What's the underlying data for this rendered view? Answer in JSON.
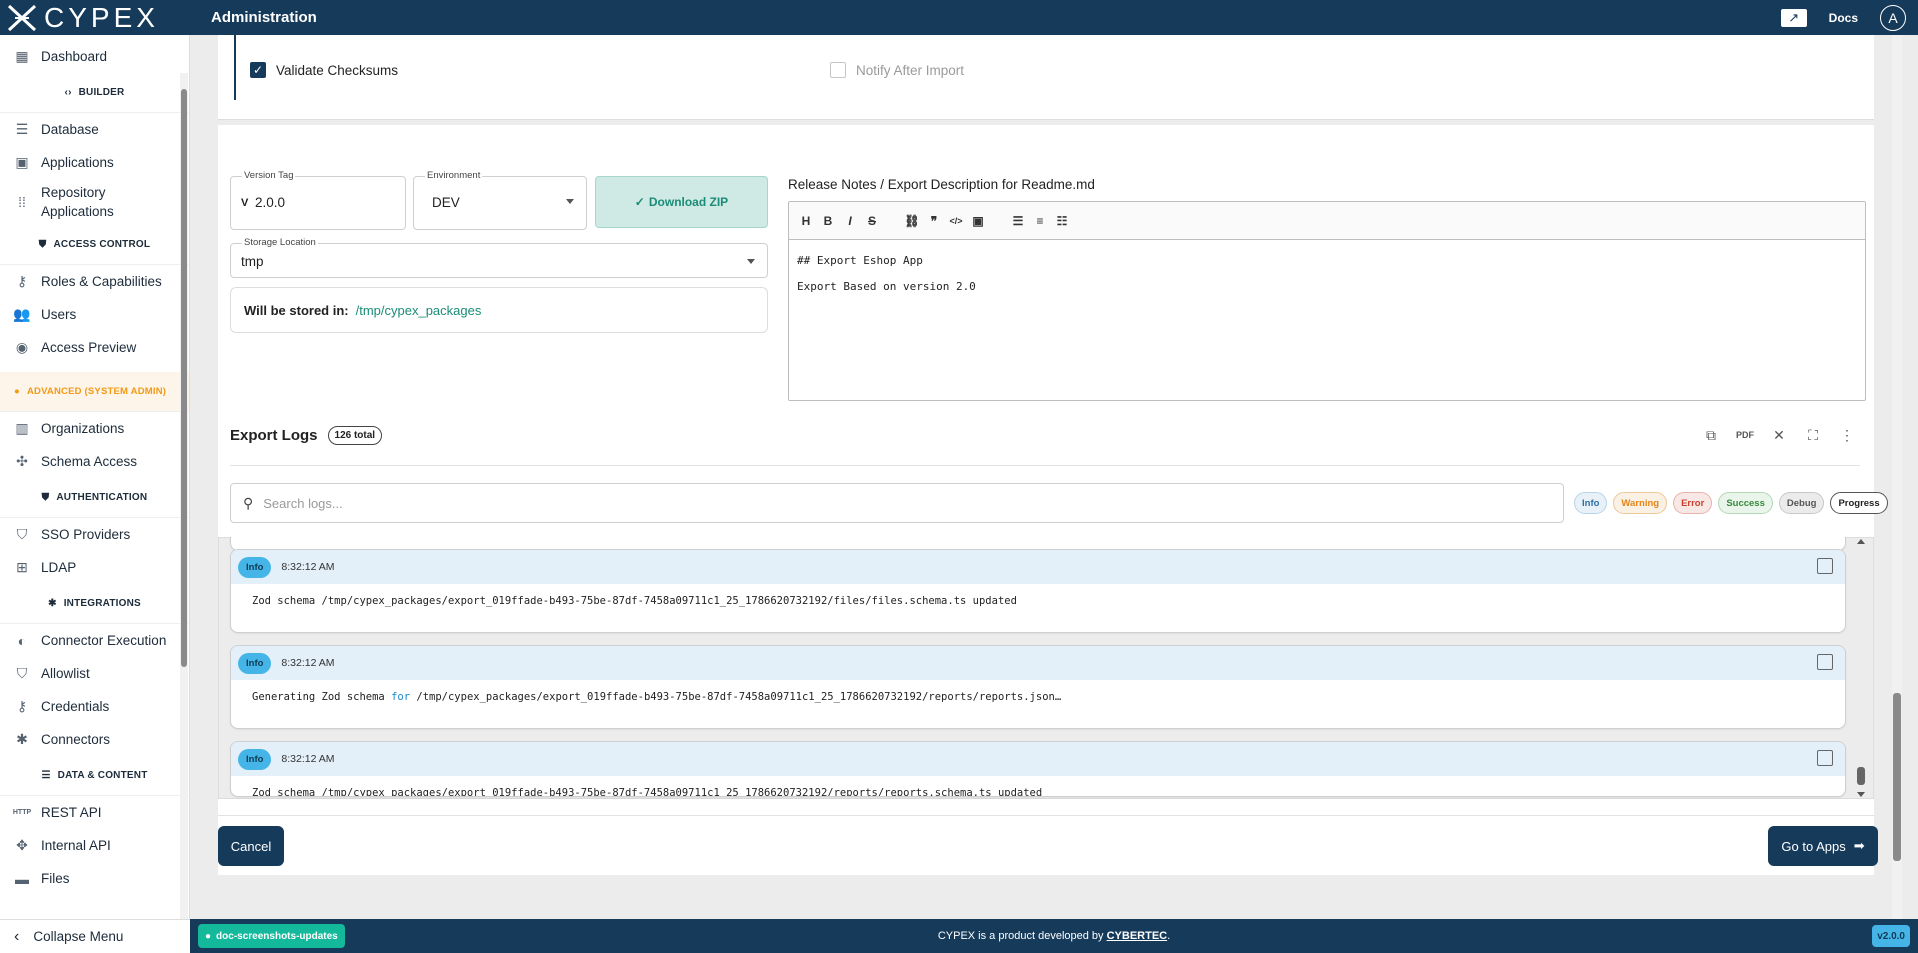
{
  "app": {
    "brand": "CYPEX",
    "page_title": "Administration",
    "docs_label": "Docs",
    "avatar_initial": "A"
  },
  "sidebar": {
    "items": [
      {
        "label": "Dashboard",
        "icon": "dashboard-icon"
      },
      {
        "section": "BUILDER",
        "icon": "code-icon"
      },
      {
        "label": "Database",
        "icon": "list-icon"
      },
      {
        "label": "Applications",
        "icon": "app-icon"
      },
      {
        "label": "Repository Applications",
        "icon": "grid-icon"
      },
      {
        "section": "ACCESS CONTROL",
        "icon": "shield-icon"
      },
      {
        "label": "Roles & Capabilities",
        "icon": "key-icon"
      },
      {
        "label": "Users",
        "icon": "users-icon"
      },
      {
        "label": "Access Preview",
        "icon": "eye-icon"
      },
      {
        "section": "ADVANCED (SYSTEM ADMIN)",
        "icon": "warning-icon"
      },
      {
        "label": "Organizations",
        "icon": "building-icon"
      },
      {
        "label": "Schema Access",
        "icon": "puzzle-icon"
      },
      {
        "section": "AUTHENTICATION",
        "icon": "verified-icon"
      },
      {
        "label": "SSO Providers",
        "icon": "shield-icon"
      },
      {
        "label": "LDAP",
        "icon": "tree-icon"
      },
      {
        "section": "INTEGRATIONS",
        "icon": "hub-icon"
      },
      {
        "label": "Connector Execution",
        "icon": "toggle-icon"
      },
      {
        "label": "Allowlist",
        "icon": "shield-icon"
      },
      {
        "label": "Credentials",
        "icon": "key-icon"
      },
      {
        "label": "Connectors",
        "icon": "hub-icon"
      },
      {
        "section": "DATA & CONTENT",
        "icon": "list-icon"
      },
      {
        "label": "REST API",
        "icon": "http-icon"
      },
      {
        "label": "Internal API",
        "icon": "api-icon"
      },
      {
        "label": "Files",
        "icon": "folder-icon"
      }
    ],
    "collapse_label": "Collapse Menu"
  },
  "options": {
    "validate_checksums": {
      "label": "Validate Checksums",
      "checked": true
    },
    "notify_after_import": {
      "label": "Notify After Import",
      "checked": false
    }
  },
  "form": {
    "version_tag": {
      "label": "Version Tag",
      "prefix": "V",
      "value": "2.0.0"
    },
    "environment": {
      "label": "Environment",
      "value": "DEV"
    },
    "download_label": "Download ZIP",
    "storage_location": {
      "label": "Storage Location",
      "value": "tmp"
    },
    "stored_in": {
      "label": "Will be stored in:",
      "path": "/tmp/cypex_packages"
    }
  },
  "release_notes": {
    "title": "Release Notes / Export Description for Readme.md",
    "toolbar": [
      "H",
      "B",
      "I",
      "S",
      "link",
      "quote",
      "code",
      "image",
      "bullet-list",
      "numbered-list",
      "task-list"
    ],
    "lines": [
      "## Export Eshop App",
      "Export Based on version 2.0"
    ]
  },
  "logs": {
    "title": "Export Logs",
    "total": "126 total",
    "search_placeholder": "Search logs...",
    "filters": [
      "Info",
      "Warning",
      "Error",
      "Success",
      "Debug",
      "Progress"
    ],
    "entries": [
      {
        "level": "Info",
        "time": "8:32:12 AM",
        "message": "Zod schema /tmp/cypex_packages/export_019ffade-b493-75be-87df-7458a09711c1_25_1786620732192/files/files.schema.ts updated"
      },
      {
        "level": "Info",
        "time": "8:32:12 AM",
        "message_pre": "Generating Zod schema ",
        "message_kw": "for",
        "message_post": " /tmp/cypex_packages/export_019ffade-b493-75be-87df-7458a09711c1_25_1786620732192/reports/reports.json…"
      },
      {
        "level": "Info",
        "time": "8:32:12 AM",
        "message": "Zod schema /tmp/cypex_packages/export_019ffade-b493-75be-87df-7458a09711c1_25_1786620732192/reports/reports.schema.ts updated"
      }
    ]
  },
  "actions": {
    "cancel": "Cancel",
    "go_to_apps": "Go to Apps"
  },
  "footer": {
    "branch": "doc-screenshots-updates",
    "text_pre": "CYPEX is a product developed by ",
    "company": "CYBERTEC",
    "text_post": ".",
    "version": "v2.0.0"
  },
  "colors": {
    "primary": "#163a5a",
    "accent": "#1a8c77",
    "info": "#45b5e8",
    "warning": "#f29a14"
  }
}
